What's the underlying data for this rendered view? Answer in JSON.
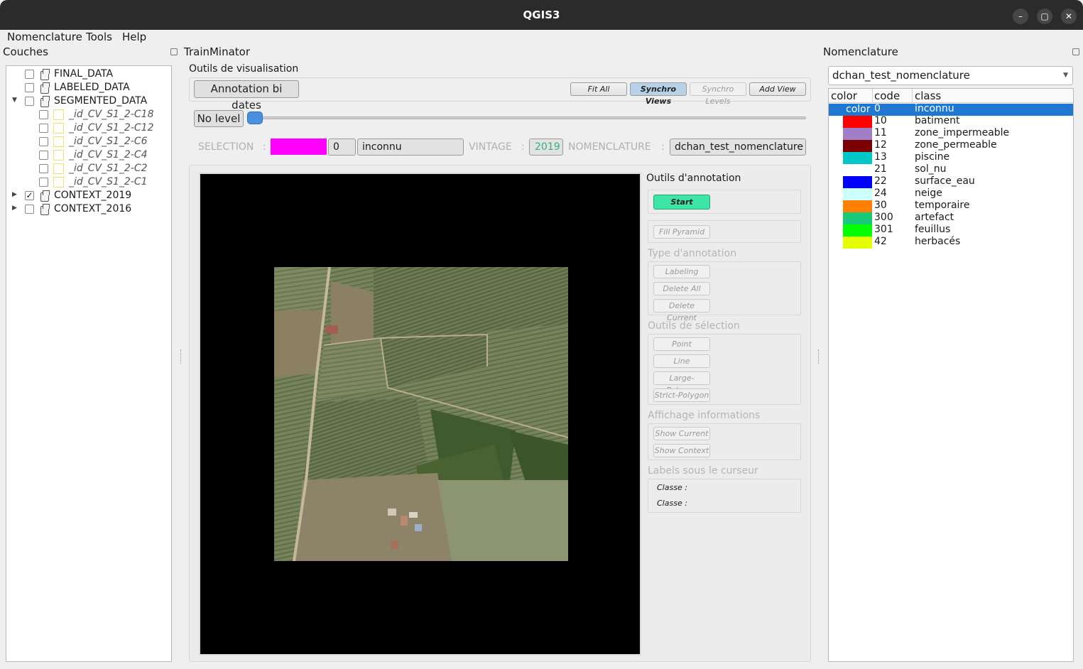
{
  "window": {
    "title": "QGIS3"
  },
  "menu": [
    "Nomenclature",
    "Tools",
    "Help"
  ],
  "couches": {
    "title": "Couches",
    "layers": [
      {
        "name": "FINAL_DATA",
        "checked": false,
        "expandable": false
      },
      {
        "name": "LABELED_DATA",
        "checked": false,
        "expandable": false
      },
      {
        "name": "SEGMENTED_DATA",
        "checked": false,
        "expandable": true,
        "expanded": true
      },
      {
        "name": "_id_CV_S1_2-C18",
        "checked": false,
        "sub": true
      },
      {
        "name": "_id_CV_S1_2-C12",
        "checked": false,
        "sub": true
      },
      {
        "name": "_id_CV_S1_2-C6",
        "checked": false,
        "sub": true
      },
      {
        "name": "_id_CV_S1_2-C4",
        "checked": false,
        "sub": true
      },
      {
        "name": "_id_CV_S1_2-C2",
        "checked": false,
        "sub": true
      },
      {
        "name": "_id_CV_S1_2-C1",
        "checked": false,
        "sub": true
      },
      {
        "name": "CONTEXT_2019",
        "checked": true,
        "expandable": true,
        "expanded": false
      },
      {
        "name": "CONTEXT_2016",
        "checked": false,
        "expandable": true,
        "expanded": false
      }
    ]
  },
  "trainminator": {
    "title": "TrainMinator",
    "vis_title": "Outils de visualisation",
    "mode_button": "Annotation bi dates",
    "fit_all": "Fit All",
    "synchro_views": "Synchro Views",
    "synchro_levels": "Synchro Levels",
    "add_view": "Add View",
    "level_button": "No level",
    "slider_value": 0,
    "selection_label": "SELECTION",
    "sep": ":",
    "selection_color": "#ff00ff",
    "selection_code": "0",
    "selection_class": "inconnu",
    "vintage_label": "VINTAGE",
    "vintage_value": "2019",
    "nomenclature_label": "NOMENCLATURE",
    "nomenclature_value": "dchan_test_nomenclature"
  },
  "annotation": {
    "title": "Outils d'annotation",
    "start": "Start",
    "fill_pyramid": "Fill Pyramid",
    "type_title": "Type d'annotation",
    "labeling": "Labeling",
    "delete_all": "Delete All",
    "delete_current": "Delete Current",
    "selection_title": "Outils de sélection",
    "point": "Point",
    "line": "Line",
    "large_polygon": "Large-Polygon",
    "strict_polygon": "Strict-Polygon",
    "info_title": "Affichage informations",
    "show_current": "Show Current",
    "show_context": "Show Context",
    "cursor_title": "Labels sous le curseur",
    "classe_1": "Classe :",
    "classe_2": "Classe :"
  },
  "nomenclature": {
    "title": "Nomenclature",
    "combo_value": "dchan_test_nomenclature",
    "headers": [
      "color",
      "code",
      "class"
    ],
    "selected_swatch_text": "color",
    "rows": [
      {
        "color": "#1e78d2",
        "code": "0",
        "class": "inconnu",
        "selected": true
      },
      {
        "color": "#ff0000",
        "code": "10",
        "class": "batiment"
      },
      {
        "color": "#a07fc8",
        "code": "11",
        "class": "zone_impermeable"
      },
      {
        "color": "#7b0000",
        "code": "12",
        "class": "zone_permeable"
      },
      {
        "color": "#00c8c8",
        "code": "13",
        "class": "piscine"
      },
      {
        "color": "#ffffff",
        "code": "21",
        "class": "sol_nu"
      },
      {
        "color": "#0000ff",
        "code": "22",
        "class": "surface_eau"
      },
      {
        "color": "#ccffff",
        "code": "24",
        "class": "neige"
      },
      {
        "color": "#ff7f00",
        "code": "30",
        "class": "temporaire"
      },
      {
        "color": "#19c878",
        "code": "300",
        "class": "artefact"
      },
      {
        "color": "#00ff00",
        "code": "301",
        "class": "feuillus"
      },
      {
        "color": "#e6ff00",
        "code": "42",
        "class": "herbacés"
      }
    ]
  }
}
